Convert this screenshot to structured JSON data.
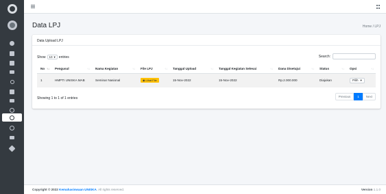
{
  "page": {
    "title": "Data LPJ",
    "breadcrumb": "Home / LPJ"
  },
  "card": {
    "header": "Data Upload LPJ"
  },
  "table_controls": {
    "show_label": "Show",
    "entries_value": "10",
    "entries_label": "entries",
    "search_label": "Search:",
    "search_value": ""
  },
  "table": {
    "columns": [
      "No",
      "Pengusul",
      "Nama Kegiatan",
      "File LPJ",
      "Tanggal Upload",
      "Tanggal Kegiatan Selesai",
      "Dana Disetujui",
      "Status",
      "Opsi"
    ],
    "rows": [
      {
        "no": "1",
        "pengusul": "HMPTI UNISKA MAB",
        "nama_kegiatan": "Seminar Nasional",
        "file_lpj": "Lihat File",
        "tanggal_upload": "15-Nov-2022",
        "tanggal_selesai": "15-Nov-2022",
        "dana": "Rp.2.000.000",
        "status": "Diajukan",
        "opsi": "Pilih"
      }
    ]
  },
  "info": "Showing 1 to 1 of 1 entries",
  "pagination": {
    "previous": "Previous",
    "current": "1",
    "next": "Next"
  },
  "footer": {
    "copyright_prefix": "Copyright © 2022",
    "org": "Kemahasiswaan UNISKA",
    "rights": ". All rights reserved.",
    "version_label": "Version",
    "version_value": "1.1.0"
  },
  "colors": {
    "sidebar": "#343a40",
    "primary": "#007bff",
    "warning": "#ffc107"
  }
}
